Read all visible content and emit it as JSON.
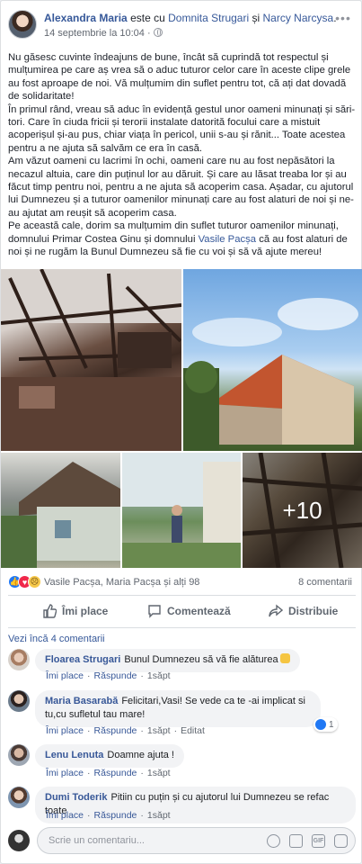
{
  "post": {
    "author": "Alexandra Maria",
    "with_text": "este cu",
    "tag1": "Domnita Strugari",
    "and_text": "și",
    "tag2": "Narcy Narcysa",
    "tag_end": ".",
    "date": "14 septembrie la 10:04 ·",
    "privacy_icon": "globe-icon",
    "more_icon": "ellipsis-icon",
    "paragraphs": [
      "Nu găsesc cuvinte îndeajuns de bune, încât să cuprindă tot respectul și mulțumirea pe care aș vrea să o aduc tuturor celor care în aceste clipe grele au fost aproape de noi. Vă mulțumim din suflet pentru tot, că ați dat dovadă de solidaritate!",
      "În primul rând, vreau să aduc în evidență gestul unor oameni minunați și sări­tori. Care în ciuda fricii și terorii instalate datorită focului care a mistuit acoperișul și-au pus, chiar viața în pericol, unii s-au și rănit... Toate acestea pentru a ne ajuta să salvăm ce era în casă.",
      "Am văzut oameni cu lacrimi în ochi, oameni care nu au fost nepăsători la necazul altuia, care din puținul lor au dăruit. Și care au lăsat treaba lor și au făcut timp pentru noi, pentru a ne ajuta să acoperim casa. Așadar, cu ajutorul lui Dumnezeu și a tuturor oamenilor minunați care au fost alaturi de noi și ne-au ajutat am reușit să acoperim casa."
    ],
    "last_para_before": "Pe această cale, dorim sa mulțumim din suflet tuturor oamenilor minunați, domnului Primar Costea Ginu și domnului",
    "last_para_link": "Vasile Pacșa",
    "last_para_after": "că au fost alaturi de noi și ne rugăm la Bunul Dumnezeu să fie cu voi și să vă ajute mereu!",
    "more_photos": "+10"
  },
  "reactions": {
    "names": "Vasile Pacșa, Maria Pacșa și alți 98",
    "comments_count": "8 comentarii",
    "types": [
      "like",
      "love",
      "sad"
    ]
  },
  "actions": {
    "like": "Îmi place",
    "comment": "Comentează",
    "share": "Distribuie"
  },
  "comments_header": "Vezi încă 4 comentarii",
  "comment_meta": {
    "like": "Îmi place",
    "reply": "Răspunde"
  },
  "comments": [
    {
      "name": "Floarea Strugari",
      "text": "Bunul Dumnezeu să vă fie alăturea",
      "time": "1săpt",
      "extra": "",
      "likes": ""
    },
    {
      "name": "Maria Basarabă",
      "text": "Felicitari,Vasi! Se vede ca te -ai implicat si tu,cu sufletul tau mare!",
      "time": "1săpt",
      "extra": "Editat",
      "likes": "1"
    },
    {
      "name": "Lenu Lenuta",
      "text": "Doamne ajuta !",
      "time": "1săpt",
      "extra": "",
      "likes": ""
    },
    {
      "name": "Dumi Toderik",
      "text": "Pitiin cu puțin și cu ajutorul lui Dumnezeu se refac toate",
      "time": "1săpt",
      "extra": "",
      "likes": ""
    }
  ],
  "composer": {
    "placeholder": "Scrie un comentariu..."
  },
  "colors": {
    "link": "#365899",
    "like_blue": "#2078f4",
    "love_red": "#f0284a",
    "bubble": "#f2f3f5"
  }
}
